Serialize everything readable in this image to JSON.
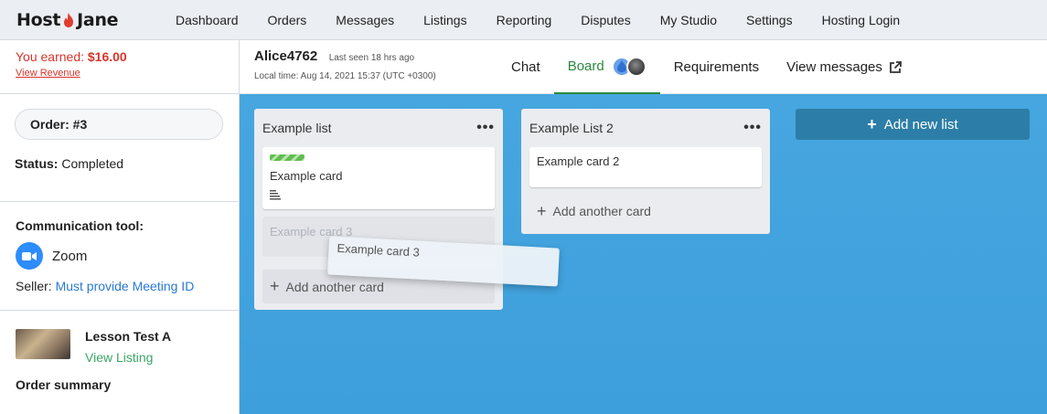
{
  "brand": {
    "name_left": "Host",
    "name_right": "Jane"
  },
  "nav": [
    "Dashboard",
    "Orders",
    "Messages",
    "Listings",
    "Reporting",
    "Disputes",
    "My Studio",
    "Settings",
    "Hosting Login"
  ],
  "sidebar": {
    "earned_label": "You earned: ",
    "earned_value": "$16.00",
    "view_revenue": "View Revenue",
    "order_label": "Order: #3",
    "status_label": "Status:",
    "status_value": "Completed",
    "comm_title": "Communication tool:",
    "comm_tool": "Zoom",
    "seller_label": "Seller:",
    "seller_link": "Must provide Meeting ID",
    "lesson_title": "Lesson Test A",
    "view_listing": "View Listing",
    "order_summary": "Order summary"
  },
  "header": {
    "username": "Alice4762",
    "last_seen": "Last seen 18 hrs ago",
    "local_time": "Local time:  Aug 14, 2021 15:37 (UTC +0300)",
    "tabs": [
      "Chat",
      "Board",
      "Requirements",
      "View messages"
    ]
  },
  "board": {
    "lists": [
      {
        "title": "Example list",
        "cards": [
          "Example card"
        ],
        "ghost_card": "Example card 3",
        "add_card": "Add another card"
      },
      {
        "title": "Example List 2",
        "cards": [
          "Example card 2"
        ],
        "add_card": "Add another card"
      }
    ],
    "dragging_card": "Example card 3",
    "add_list": "Add new list"
  },
  "colors": {
    "board_bg": "#47a6df",
    "accent_green": "#2a8a3c",
    "earned_red": "#d9342b",
    "add_list_bg": "#2c7ea8"
  }
}
